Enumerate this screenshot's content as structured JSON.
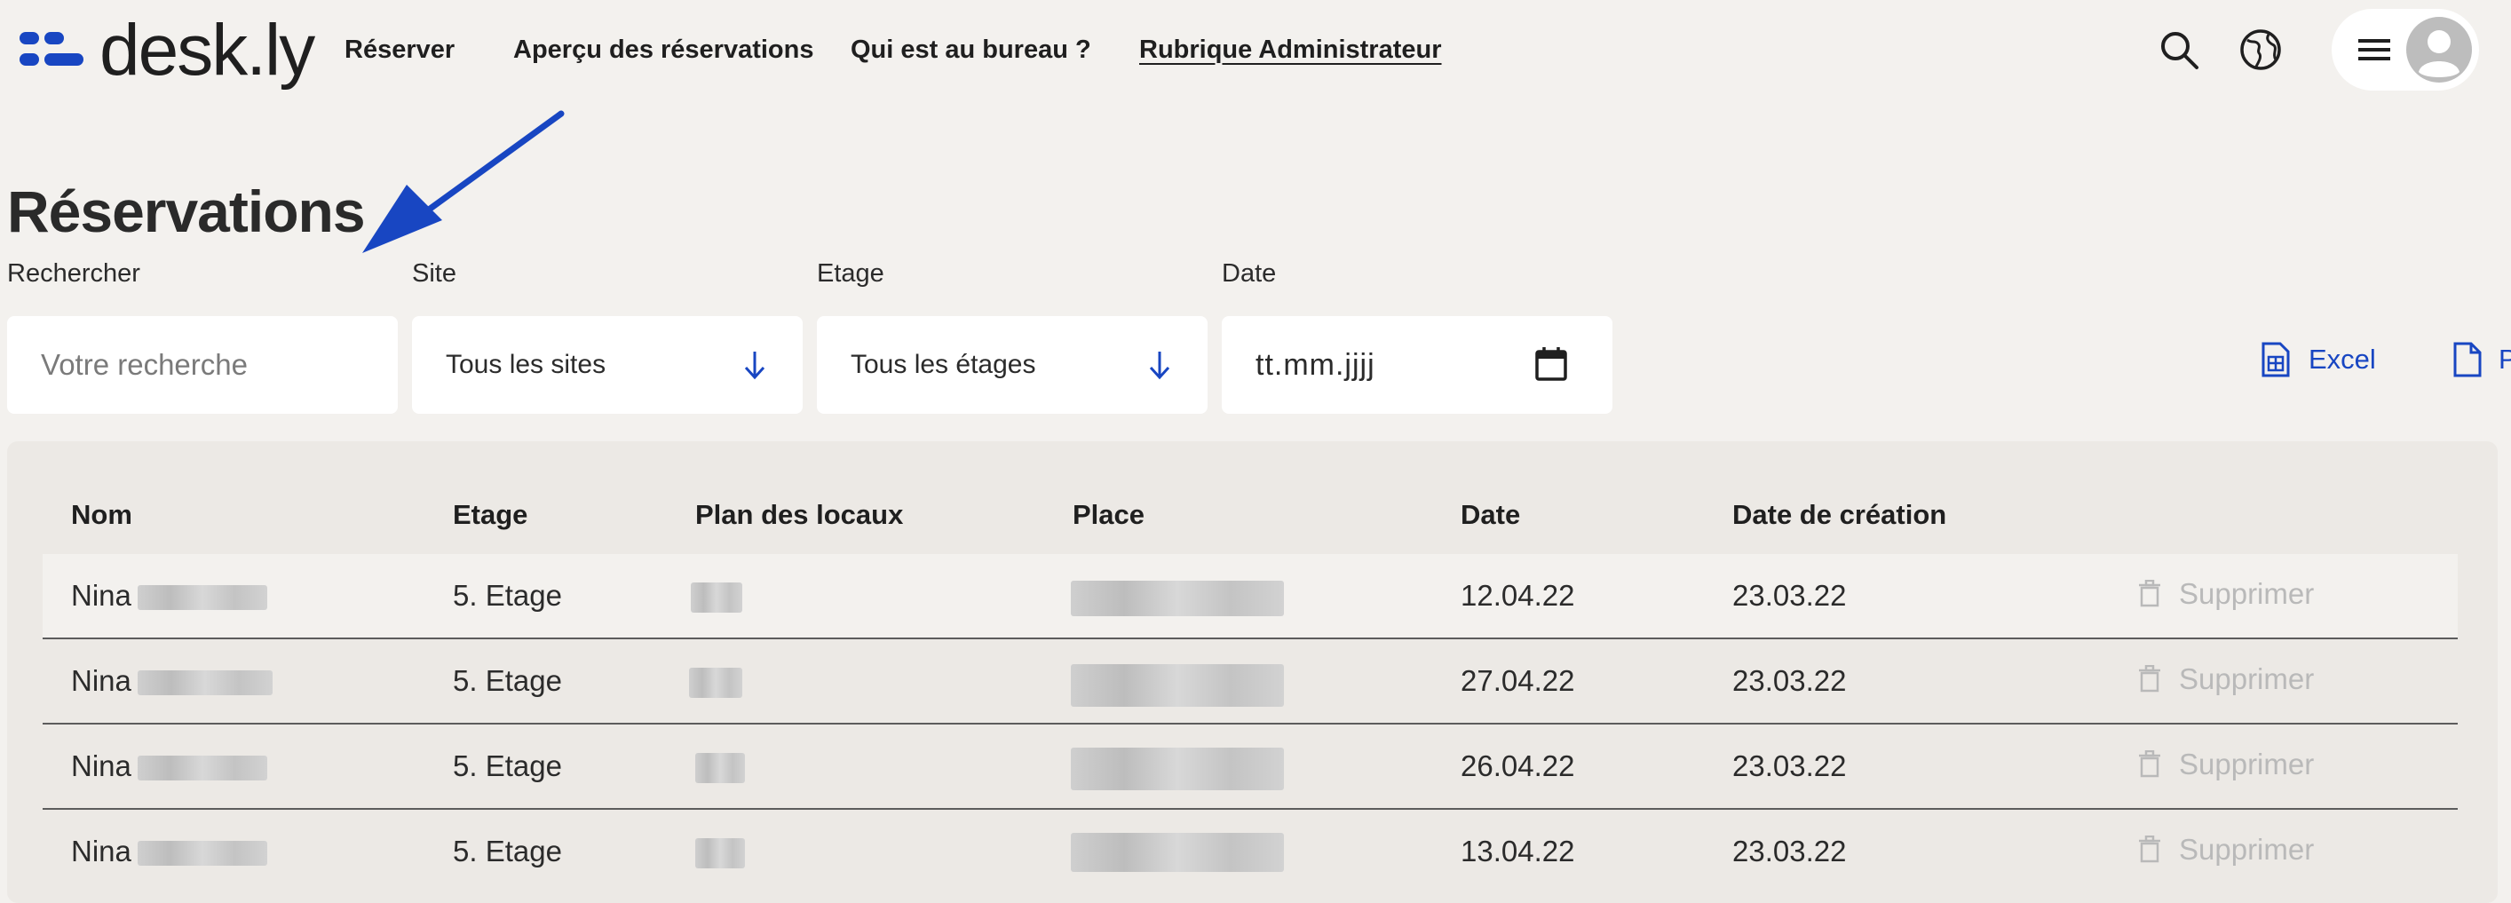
{
  "app": {
    "brand": "desk.ly",
    "brand_color": "#1846c2"
  },
  "nav": {
    "items": [
      {
        "label": "Réserver"
      },
      {
        "label": "Aperçu des réservations"
      },
      {
        "label": "Qui est au bureau ?"
      },
      {
        "label": "Rubrique Administrateur",
        "active": true
      }
    ]
  },
  "header_icons": [
    "search-icon",
    "globe-icon",
    "hamburger-icon",
    "avatar-icon"
  ],
  "page": {
    "title": "Réservations"
  },
  "filters": {
    "search": {
      "label": "Rechercher",
      "placeholder": "Votre recherche"
    },
    "site": {
      "label": "Site",
      "value": "Tous les sites"
    },
    "floor": {
      "label": "Etage",
      "value": "Tous les étages"
    },
    "date": {
      "label": "Date",
      "value": "tt.mm.jjjj"
    }
  },
  "export": {
    "excel": "Excel",
    "pdf": "Pdf"
  },
  "table": {
    "headers": [
      "Nom",
      "Etage",
      "Plan des locaux",
      "Place",
      "Date",
      "Date de création"
    ],
    "delete_label": "Supprimer",
    "rows": [
      {
        "name": "Nina",
        "floor": "5. Etage",
        "date": "12.04.22",
        "created": "23.03.22"
      },
      {
        "name": "Nina",
        "floor": "5. Etage",
        "date": "27.04.22",
        "created": "23.03.22"
      },
      {
        "name": "Nina",
        "floor": "5. Etage",
        "date": "26.04.22",
        "created": "23.03.22"
      },
      {
        "name": "Nina",
        "floor": "5. Etage",
        "date": "13.04.22",
        "created": "23.03.22"
      }
    ]
  }
}
